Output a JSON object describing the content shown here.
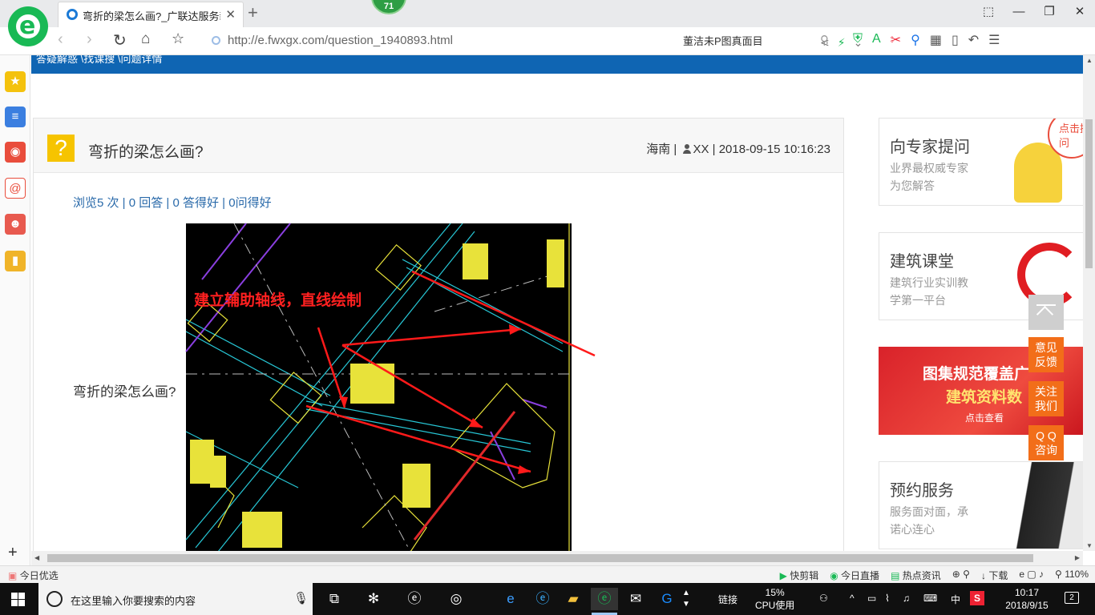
{
  "browser": {
    "tab_title": "弯折的梁怎么画?_广联达服务新",
    "tab_close": "✕",
    "new_tab": "+",
    "badge": "71",
    "url": "http://e.fwxgx.com/question_1940893.html",
    "search_text": "董洁未P图真面目",
    "window_buttons": [
      "⬚",
      "—",
      "❐",
      "✕"
    ]
  },
  "page": {
    "breadcrumb": "答疑解惑 \\找课搜 \\问题详情",
    "question": {
      "title": "弯折的梁怎么画?",
      "location": "海南 |",
      "user": "XX",
      "datetime": "| 2018-09-15 10:16:23",
      "stats": "浏览5 次 | 0 回答 | 0 答得好 | 0问得好",
      "body_text": "弯折的梁怎么画?",
      "image_annotation": "建立辅助轴线，直线绘制"
    }
  },
  "sidebar_ads": {
    "expert": {
      "title": "向专家提问",
      "sub1": "业界最权威专家",
      "sub2": "为您解答",
      "bubble": "点击提问"
    },
    "class": {
      "title": "建筑课堂",
      "sub1": "建筑行业实训教",
      "sub2": "学第一平台"
    },
    "banner": {
      "line1": "图集规范覆盖广",
      "line2": "建筑资料数",
      "button": "点击查看"
    },
    "service": {
      "title": "预约服务",
      "sub1": "服务面对面，承",
      "sub2": "诺心连心"
    }
  },
  "float_buttons": {
    "feedback": [
      "意见",
      "反馈"
    ],
    "follow": [
      "关注",
      "我们"
    ],
    "qq": [
      "Q Q",
      "咨询"
    ]
  },
  "statusbar": {
    "left": "今日优选",
    "items": [
      "快剪辑",
      "今日直播",
      "热点资讯",
      "下载",
      "110%"
    ]
  },
  "taskbar": {
    "search_placeholder": "在这里输入你要搜索的内容",
    "link_label": "链接",
    "cpu_percent": "15%",
    "cpu_label": "CPU使用",
    "ime": "中",
    "time": "10:17",
    "date": "2018/9/15",
    "notifications": "2"
  }
}
